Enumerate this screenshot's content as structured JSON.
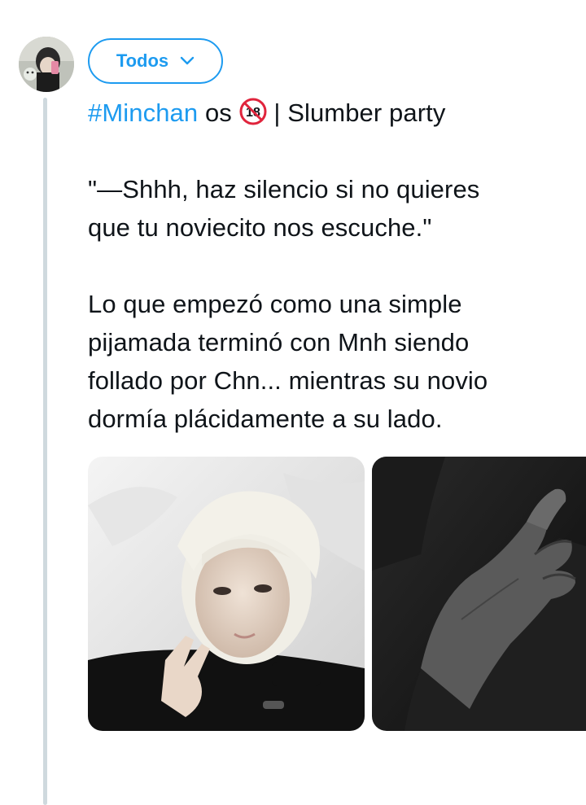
{
  "audience": {
    "label": "Todos",
    "icon": "chevron-down-icon"
  },
  "tweet": {
    "hashtag": "#Minchan",
    "title_middle": "os",
    "badge_text": "18",
    "title_rest": "| Slumber party",
    "quote_line1": "\"—Shhh, haz silencio si no quieres",
    "quote_line2": "que tu noviecito nos escuche.\"",
    "body_line1": "Lo que empezó como una simple",
    "body_line2": "pijamada terminó con Mnh siendo",
    "body_line3": "follado por Chn... mientras su novio",
    "body_line4": "dormía plácidamente a su lado."
  },
  "colors": {
    "accent": "#1d9bf0",
    "text": "#0f1419",
    "thread_line": "#cfd9de",
    "badge_red": "#e0243c"
  },
  "media": [
    {
      "name": "selfie-photo"
    },
    {
      "name": "hand-photo"
    }
  ]
}
